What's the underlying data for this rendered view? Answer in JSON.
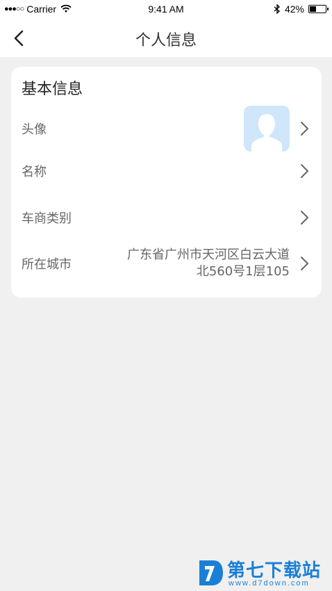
{
  "status_bar": {
    "carrier": "Carrier",
    "time": "9:41 AM",
    "battery": "42%",
    "battery_level": 0.42
  },
  "nav": {
    "title": "个人信息"
  },
  "card": {
    "section_title": "基本信息",
    "rows": [
      {
        "label": "头像"
      },
      {
        "label": "名称",
        "value": ""
      },
      {
        "label": "车商类别",
        "value": ""
      },
      {
        "label": "所在城市",
        "value_line1": "广东省广州市天河区白云大道",
        "value_line2": "北560号1层105"
      }
    ]
  },
  "watermark": {
    "title": "第七下载站",
    "url": "www.d7down.com"
  },
  "colors": {
    "background": "#f0f0f0",
    "card": "#ffffff",
    "label": "#666666",
    "avatar_bg": "#cfe6fb",
    "avatar_fg": "#ffffff",
    "brand": "#1a7fd6"
  }
}
